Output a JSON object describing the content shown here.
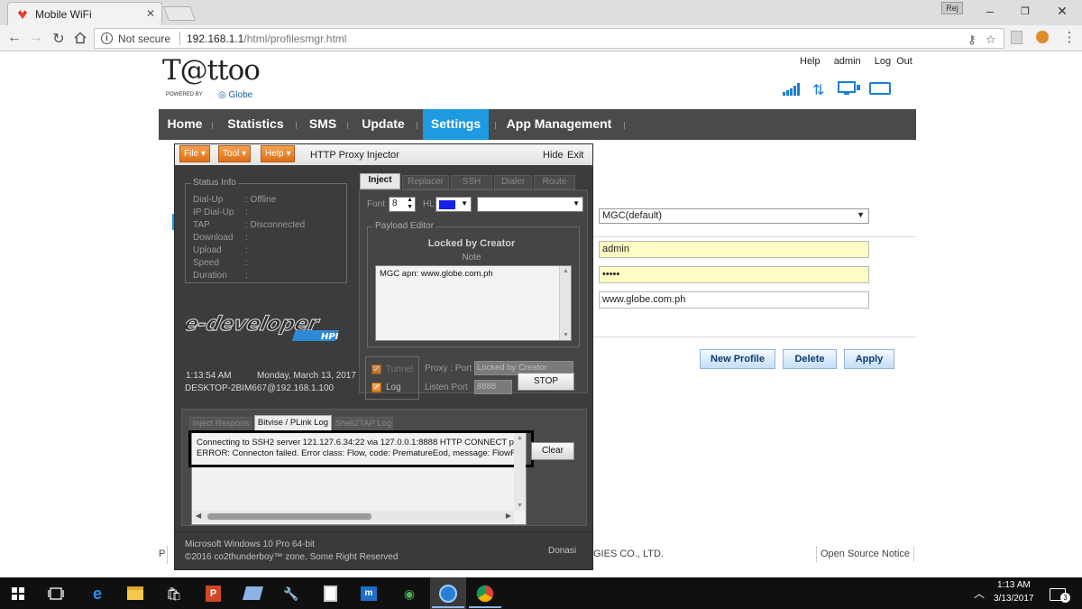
{
  "browser": {
    "tab_title": "Mobile WiFi",
    "user_badge": "Rej",
    "not_secure": "Not secure",
    "url_host": "192.168.1.1",
    "url_path": "/html/profilesmgr.html"
  },
  "router": {
    "brand": "T@ttoo",
    "powered_by": "POWERED BY",
    "globe": "Globe",
    "top_links": [
      "Help",
      "admin",
      "Log Out"
    ],
    "nav": [
      "Home",
      "Statistics",
      "SMS",
      "Update",
      "Settings",
      "App Management"
    ],
    "profile_select": "MGC(default)",
    "username": "admin",
    "password": "•••••",
    "apn": "www.globe.com.ph",
    "buttons": {
      "new_profile": "New Profile",
      "delete": "Delete",
      "apply": "Apply"
    },
    "footer_left": "P",
    "footer_copyright": "GIES CO., LTD.",
    "footer_oss": "Open Source Notice"
  },
  "injector": {
    "menus": [
      "File",
      "Tool",
      "Help"
    ],
    "title": "HTTP Proxy Injector",
    "hide": "Hide",
    "exit": "Exit",
    "status_title": "Status Info",
    "status": [
      {
        "label": "Dial-Up",
        "value": ": Offline"
      },
      {
        "label": "IP Dial-Up",
        "value": ":"
      },
      {
        "label": "TAP",
        "value": ": Disconnected"
      },
      {
        "label": "Download",
        "value": ":"
      },
      {
        "label": "Upload",
        "value": ":"
      },
      {
        "label": "Speed",
        "value": ":"
      },
      {
        "label": "Duration",
        "value": ":"
      }
    ],
    "banner_text": "e-developer",
    "banner_sub": "HPI",
    "time": "1:13:54 AM",
    "date": "Monday, March 13, 2017",
    "host": "DESKTOP-2BIM667@192.168.1.100",
    "tabs": [
      "Inject",
      "Replacer",
      "SSH",
      "Dialer",
      "Route"
    ],
    "font_label": "Font",
    "font_size": "8",
    "hl_label": "HL",
    "payload_title": "Payload Editor",
    "locked": "Locked by Creator",
    "note": "Note",
    "payload": "MGC apn: www.globe.com.ph",
    "tunnel": "Tunnel",
    "log": "Log",
    "proxy_port_label": "Proxy : Port",
    "proxy_value": "Locked by Creator",
    "listen_port_label": "Listen Port",
    "listen_port": "8888",
    "stop": "STOP",
    "log_tabs": [
      "Inject Respons",
      "Bitvise / PLink Log",
      "Shell2TAP Log"
    ],
    "log_lines": [
      "Connecting to SSH2 server 121.127.6.34:22 via 127.0.0.1:8888 HTTP CONNECT p",
      "ERROR: Connecton failed. Error class: Flow, code: PrematureEod, message: FlowF"
    ],
    "clear": "Clear",
    "footer_os": "Microsoft Windows 10 Pro 64-bit",
    "footer_copyright": "©2016 co2thunderboy™ zone, Some Right Reserved",
    "footer_dev": "Donasi"
  },
  "taskbar": {
    "time": "1:13 AM",
    "date": "3/13/2017",
    "notifications": "3"
  },
  "colors": {
    "nav_active": "#1e9ae0",
    "nav_bg": "#4a4a4a",
    "menu_orange": "#e87c1f",
    "input_yellow": "#fcfcc4"
  }
}
